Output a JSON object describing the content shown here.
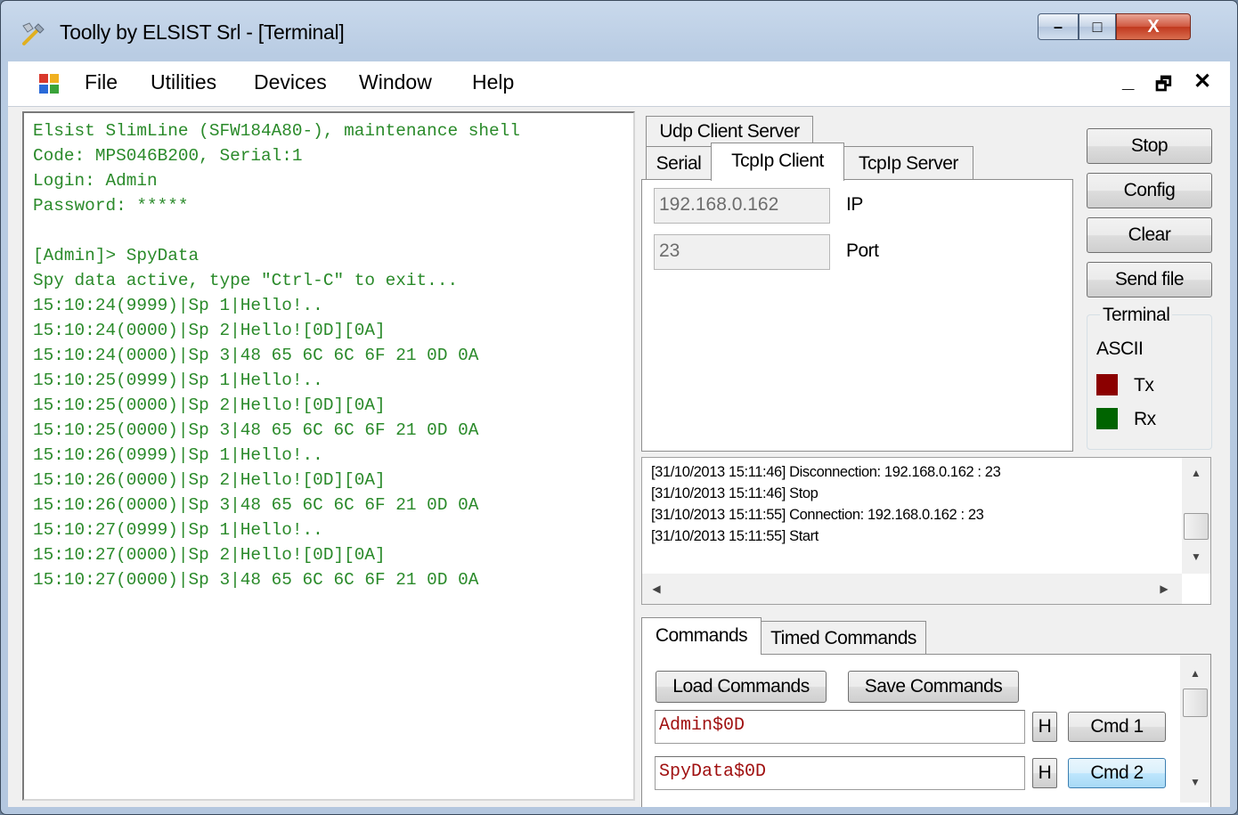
{
  "window": {
    "title": "Toolly by ELSIST Srl - [Terminal]",
    "caption": {
      "minimize": "–",
      "maximize": "□",
      "close": "X"
    }
  },
  "menu": {
    "items": [
      "File",
      "Utilities",
      "Devices",
      "Window",
      "Help"
    ],
    "mdi_controls": {
      "minimize": "_",
      "restore": "🗗",
      "close": "✕"
    }
  },
  "terminal": {
    "lines": [
      "Elsist SlimLine (SFW184A80-), maintenance shell",
      "Code: MPS046B200, Serial:1",
      "Login: Admin",
      "Password: *****",
      "",
      "[Admin]> SpyData",
      "Spy data active, type \"Ctrl-C\" to exit...",
      "15:10:24(9999)|Sp 1|Hello!..",
      "15:10:24(0000)|Sp 2|Hello![0D][0A]",
      "15:10:24(0000)|Sp 3|48 65 6C 6C 6F 21 0D 0A",
      "15:10:25(0999)|Sp 1|Hello!..",
      "15:10:25(0000)|Sp 2|Hello![0D][0A]",
      "15:10:25(0000)|Sp 3|48 65 6C 6C 6F 21 0D 0A",
      "15:10:26(0999)|Sp 1|Hello!..",
      "15:10:26(0000)|Sp 2|Hello![0D][0A]",
      "15:10:26(0000)|Sp 3|48 65 6C 6C 6F 21 0D 0A",
      "15:10:27(0999)|Sp 1|Hello!..",
      "15:10:27(0000)|Sp 2|Hello![0D][0A]",
      "15:10:27(0000)|Sp 3|48 65 6C 6C 6F 21 0D 0A"
    ],
    "text_color": "#2a8a2a"
  },
  "connection_tabs": {
    "row_top": [
      "Udp Client Server"
    ],
    "row_bottom": [
      "Serial",
      "TcpIp Client",
      "TcpIp Server"
    ],
    "active": "TcpIp Client"
  },
  "tcpip_client": {
    "ip_value": "192.168.0.162",
    "ip_label": "IP",
    "port_value": "23",
    "port_label": "Port"
  },
  "actions": {
    "stop": "Stop",
    "config": "Config",
    "clear": "Clear",
    "send_file": "Send file"
  },
  "terminal_group": {
    "title": "Terminal",
    "mode": "ASCII",
    "tx_label": "Tx",
    "rx_label": "Rx",
    "tx_color": "#8b0000",
    "rx_color": "#006400"
  },
  "log": {
    "lines": [
      "[31/10/2013 15:11:46] Disconnection: 192.168.0.162 : 23",
      "[31/10/2013 15:11:46] Stop",
      "[31/10/2013 15:11:55] Connection: 192.168.0.162 : 23",
      "[31/10/2013 15:11:55] Start"
    ]
  },
  "command_tabs": {
    "tabs": [
      "Commands",
      "Timed Commands"
    ],
    "active": "Commands"
  },
  "commands": {
    "load": "Load Commands",
    "save": "Save Commands",
    "rows": [
      {
        "value": "Admin$0D",
        "h": "H",
        "cmd": "Cmd 1"
      },
      {
        "value": "SpyData$0D",
        "h": "H",
        "cmd": "Cmd 2"
      }
    ]
  },
  "scroll_glyphs": {
    "up": "▲",
    "down": "▼",
    "left": "◀",
    "right": "▶"
  }
}
